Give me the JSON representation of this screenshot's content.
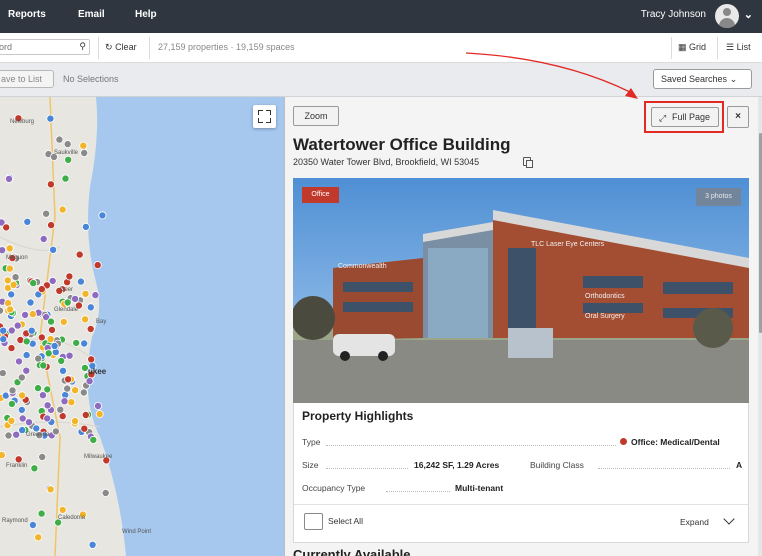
{
  "topnav": {
    "items": [
      "Reports",
      "Email",
      "Help"
    ],
    "user_name": "Tracy Johnson"
  },
  "search": {
    "placeholder": "ord",
    "clear_label": "Clear",
    "count_text": "27,159 properties · 19,159 spaces",
    "grid_label": "Grid",
    "list_label": "List"
  },
  "selection": {
    "save_label": "ave to List",
    "no_selections": "No Selections",
    "saved_searches": "Saved Searches"
  },
  "map": {
    "towns": [
      "Newburg",
      "Saukville",
      "Mequon",
      "Glendale",
      "Bay",
      "Franklin",
      "Raymond",
      "Caledonia",
      "Wind Point",
      "Deer",
      "Milwaukee",
      "Greenda"
    ],
    "city_label": "ukee"
  },
  "detail": {
    "zoom_label": "Zoom",
    "full_page_label": "Full Page",
    "close_label": "×",
    "title": "Watertower Office Building",
    "address": "20350 Water Tower Blvd, Brookfield, WI 53045",
    "type_badge": "Office",
    "photos_badge": "3 photos",
    "signs": [
      "TLC Laser Eye Centers",
      "Commonwealth",
      "Orthodontics",
      "Oral Surgery"
    ],
    "highlights": {
      "title": "Property Highlights",
      "type_label": "Type",
      "type_value": "Office: Medical/Dental",
      "size_label": "Size",
      "size_value": "16,242 SF, 1.29 Acres",
      "class_label": "Building Class",
      "class_value": "A",
      "occupancy_label": "Occupancy Type",
      "occupancy_value": "Multi-tenant",
      "select_all": "Select All",
      "expand": "Expand"
    },
    "next_section": "Currently Available"
  },
  "colors": {
    "nav_bg": "#2f3640",
    "accent_red": "#c0392b",
    "annotation_red": "#e22a25",
    "water": "#a6c8ef"
  },
  "icons": [
    "search-icon",
    "refresh-icon",
    "grid-icon",
    "list-icon",
    "chevron-down-icon",
    "expand-icon",
    "close-icon",
    "copy-icon",
    "fullscreen-icon",
    "user-avatar-icon"
  ]
}
